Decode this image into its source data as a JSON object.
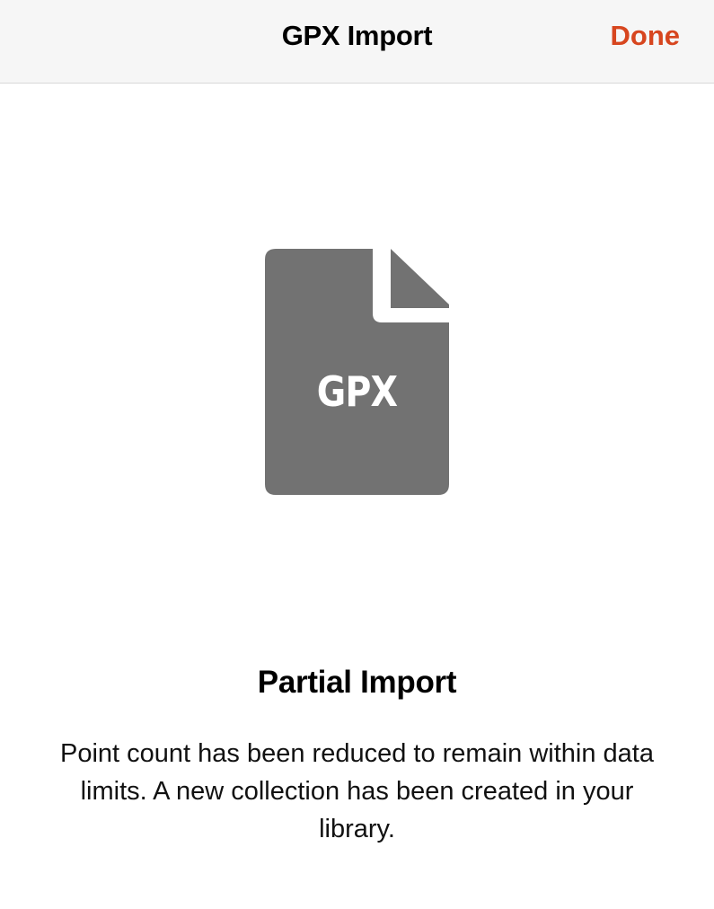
{
  "header": {
    "title": "GPX Import",
    "done_label": "Done"
  },
  "file_icon": {
    "name": "document-icon",
    "label": "GPX",
    "color": "#727272"
  },
  "status": {
    "title": "Partial Import",
    "message": "Point count has been reduced to remain within data limits. A new collection has been created in your library."
  },
  "colors": {
    "accent": "#d7461f",
    "nav_background": "#f6f6f6",
    "icon_fill": "#727272"
  }
}
